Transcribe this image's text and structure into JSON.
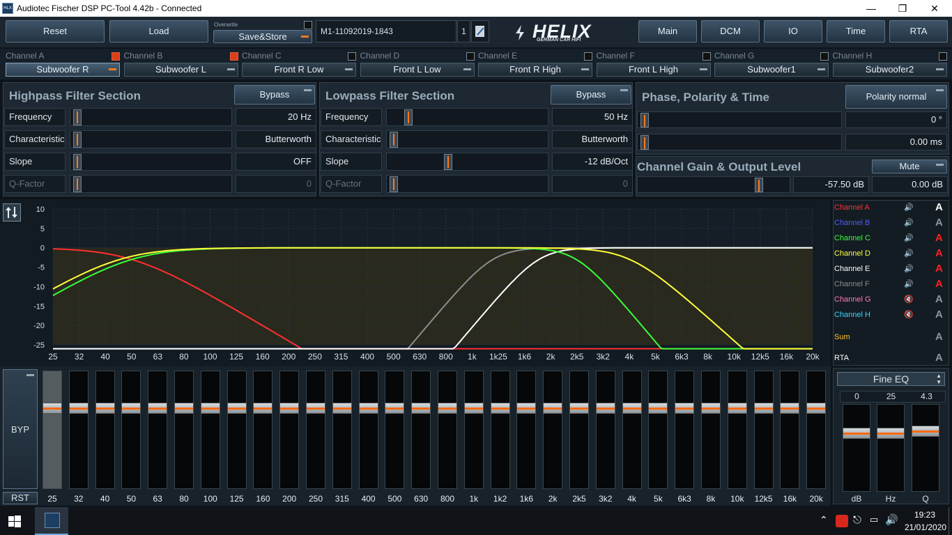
{
  "window": {
    "title": "Audiotec Fischer DSP PC-Tool 4.42b - Connected"
  },
  "toolbar": {
    "reset": "Reset",
    "load": "Load",
    "overwrite": "Overwrite",
    "save_store": "Save&Store",
    "preset_name": "M1-11092019-1843",
    "preset_slot": "1",
    "brand": "HELIX",
    "brand_sub": "GERMAN CAR HIFI",
    "nav": [
      "Main",
      "DCM",
      "IO",
      "Time",
      "RTA"
    ]
  },
  "channels": [
    {
      "label": "Channel A",
      "name": "Subwoofer R",
      "checked": true
    },
    {
      "label": "Channel B",
      "name": "Subwoofer L",
      "checked": true
    },
    {
      "label": "Channel C",
      "name": "Front R Low",
      "checked": false
    },
    {
      "label": "Channel D",
      "name": "Front L Low",
      "checked": false
    },
    {
      "label": "Channel E",
      "name": "Front R High",
      "checked": false
    },
    {
      "label": "Channel F",
      "name": "Front L High",
      "checked": false
    },
    {
      "label": "Channel G",
      "name": "Subwoofer1",
      "checked": false
    },
    {
      "label": "Channel H",
      "name": "Subwoofer2",
      "checked": false
    }
  ],
  "highpass": {
    "title": "Highpass Filter Section",
    "bypass": "Bypass",
    "rows": [
      {
        "label": "Frequency",
        "value": "20 Hz",
        "pos": 0.0
      },
      {
        "label": "Characteristic",
        "value": "Butterworth",
        "pos": 0.0
      },
      {
        "label": "Slope",
        "value": "OFF",
        "pos": 0.0
      },
      {
        "label": "Q-Factor",
        "value": "0",
        "pos": 0.0
      }
    ]
  },
  "lowpass": {
    "title": "Lowpass Filter Section",
    "bypass": "Bypass",
    "rows": [
      {
        "label": "Frequency",
        "value": "50 Hz",
        "pos": 0.1
      },
      {
        "label": "Characteristic",
        "value": "Butterworth",
        "pos": 0.0
      },
      {
        "label": "Slope",
        "value": "-12 dB/Oct",
        "pos": 0.37
      },
      {
        "label": "Q-Factor",
        "value": "0",
        "pos": 0.0
      }
    ]
  },
  "phase": {
    "title": "Phase, Polarity & Time",
    "polarity": "Polarity normal",
    "phase_value": "0 °",
    "time_value": "0.00 ms"
  },
  "gain": {
    "title": "Channel Gain & Output Level",
    "mute": "Mute",
    "gain_value": "-57.50 dB",
    "output_value": "0.00 dB",
    "gain_pos": 0.82
  },
  "graph": {
    "yticks": [
      "10",
      "5",
      "0",
      "-5",
      "-10",
      "-15",
      "-20",
      "-25"
    ],
    "xticks": [
      "25",
      "32",
      "40",
      "50",
      "63",
      "80",
      "100",
      "125",
      "160",
      "200",
      "250",
      "315",
      "400",
      "500",
      "630",
      "800",
      "1k",
      "1k25",
      "1k6",
      "2k",
      "2k5",
      "3k2",
      "4k",
      "5k",
      "6k3",
      "8k",
      "10k",
      "12k5",
      "16k",
      "20k"
    ]
  },
  "legend": [
    {
      "label": "Channel A",
      "color": "#ff3030",
      "speaker": "on",
      "a_color": "#ffffff"
    },
    {
      "label": "Channel B",
      "color": "#4e5cff",
      "speaker": "on",
      "a_color": "#8d959b"
    },
    {
      "label": "Channel C",
      "color": "#39ff39",
      "speaker": "on",
      "a_color": "#ff2020"
    },
    {
      "label": "Channel D",
      "color": "#ffff3a",
      "speaker": "on",
      "a_color": "#ff2020"
    },
    {
      "label": "Channel E",
      "color": "#ffffff",
      "speaker": "on",
      "a_color": "#ff2020"
    },
    {
      "label": "Channel F",
      "color": "#8d8d8d",
      "speaker": "on",
      "a_color": "#ff2020"
    },
    {
      "label": "Channel G",
      "color": "#ff7ab0",
      "speaker": "muted",
      "a_color": "#8d959b"
    },
    {
      "label": "Channel H",
      "color": "#35d8ff",
      "speaker": "muted",
      "a_color": "#8d959b"
    },
    {
      "label": "Sum",
      "color": "#ffc22a",
      "speaker": "",
      "a_color": "#8d959b"
    },
    {
      "label": "RTA",
      "color": "#ffffff",
      "speaker": "",
      "a_color": "#8d959b"
    }
  ],
  "eq": {
    "byp": "BYP",
    "rst": "RST",
    "bands": [
      "25",
      "32",
      "40",
      "50",
      "63",
      "80",
      "100",
      "125",
      "160",
      "200",
      "250",
      "315",
      "400",
      "500",
      "630",
      "800",
      "1k",
      "1k2",
      "1k6",
      "2k",
      "2k5",
      "3k2",
      "4k",
      "5k",
      "6k3",
      "8k",
      "10k",
      "12k5",
      "16k",
      "20k"
    ]
  },
  "fine_eq": {
    "mode": "Fine EQ",
    "values": [
      "0",
      "25",
      "4.3"
    ],
    "labels": [
      "dB",
      "Hz",
      "Q"
    ]
  },
  "taskbar": {
    "time": "19:23",
    "date": "21/01/2020"
  }
}
